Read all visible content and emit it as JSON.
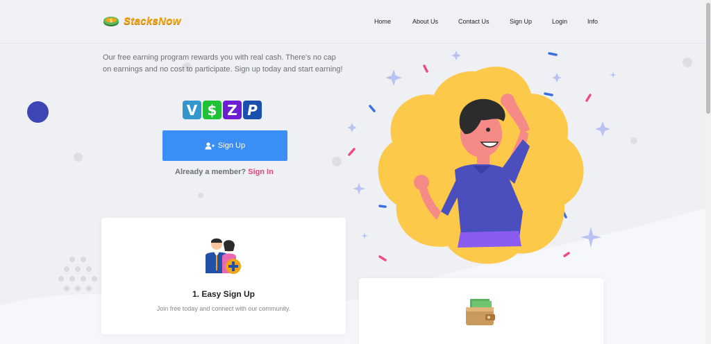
{
  "brand": {
    "name": "StacksNow"
  },
  "nav": {
    "items": [
      {
        "label": "Home"
      },
      {
        "label": "About Us"
      },
      {
        "label": "Contact Us"
      },
      {
        "label": "Sign Up"
      },
      {
        "label": "Login"
      },
      {
        "label": "Info"
      }
    ]
  },
  "hero": {
    "intro": "Our free earning program rewards you with real cash. There's no cap on earnings and no cost to participate. Sign up today and start earning!",
    "signup_button": "Sign Up",
    "member_text": "Already a member?",
    "signin_link": "Sign In"
  },
  "payment_methods": [
    {
      "name": "venmo-icon",
      "glyph": "V",
      "color": "#3396cd"
    },
    {
      "name": "cashapp-icon",
      "glyph": "$",
      "color": "#1fc234"
    },
    {
      "name": "zelle-icon",
      "glyph": "Z",
      "color": "#6d1ed4"
    },
    {
      "name": "paypal-icon",
      "glyph": "P",
      "color": "#1b4fae"
    }
  ],
  "cards": [
    {
      "title": "1. Easy Sign Up",
      "desc": "Join free today and connect with our community."
    },
    {
      "title": "",
      "desc": ""
    }
  ],
  "colors": {
    "accent": "#3a8ef6",
    "link": "#e8407a",
    "brand": "#f2a516",
    "blob": "#fdc94a"
  }
}
